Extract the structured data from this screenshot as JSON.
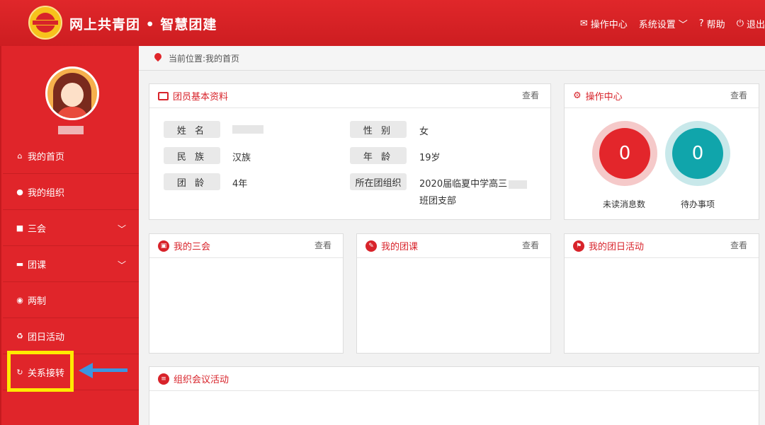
{
  "header": {
    "title": "网上共青团 • 智慧团建",
    "nav": {
      "ops_center": "操作中心",
      "system_settings": "系统设置",
      "help": "帮助",
      "logout": "退出"
    }
  },
  "sidebar": {
    "items": [
      {
        "label": "我的首页",
        "icon": "home-icon"
      },
      {
        "label": "我的组织",
        "icon": "group-icon"
      },
      {
        "label": "三会",
        "icon": "edit-icon",
        "expandable": true
      },
      {
        "label": "团课",
        "icon": "folder-icon",
        "expandable": true
      },
      {
        "label": "两制",
        "icon": "target-icon"
      },
      {
        "label": "团日活动",
        "icon": "recycle-icon"
      },
      {
        "label": "关系接转",
        "icon": "refresh-icon"
      }
    ]
  },
  "breadcrumb": {
    "text": "当前位置:我的首页"
  },
  "profile": {
    "title": "团员基本资料",
    "more": "查看",
    "fields": {
      "name_label": "姓 名",
      "gender_label": "性 别",
      "gender_value": "女",
      "ethnicity_label": "民 族",
      "ethnicity_value": "汉族",
      "age_label": "年 龄",
      "age_value": "19岁",
      "league_age_label": "团 龄",
      "league_age_value": "4年",
      "org_label": "所在团组织",
      "org_value_line1": "2020届临夏中学高三",
      "org_value_line2": "班团支部"
    }
  },
  "ops": {
    "title": "操作中心",
    "more": "查看",
    "unread_count": "0",
    "unread_label": "未读消息数",
    "todo_count": "0",
    "todo_label": "待办事项"
  },
  "panels": {
    "three_meetings": {
      "title": "我的三会",
      "more": "查看"
    },
    "league_class": {
      "title": "我的团课",
      "more": "查看"
    },
    "league_day": {
      "title": "我的团日活动",
      "more": "查看"
    },
    "org_meeting": {
      "title": "组织会议活动"
    }
  },
  "colors": {
    "brand_red": "#d8232a",
    "teal": "#10a5ab",
    "highlight_yellow": "#ffea00",
    "arrow_blue": "#3d95e0"
  }
}
